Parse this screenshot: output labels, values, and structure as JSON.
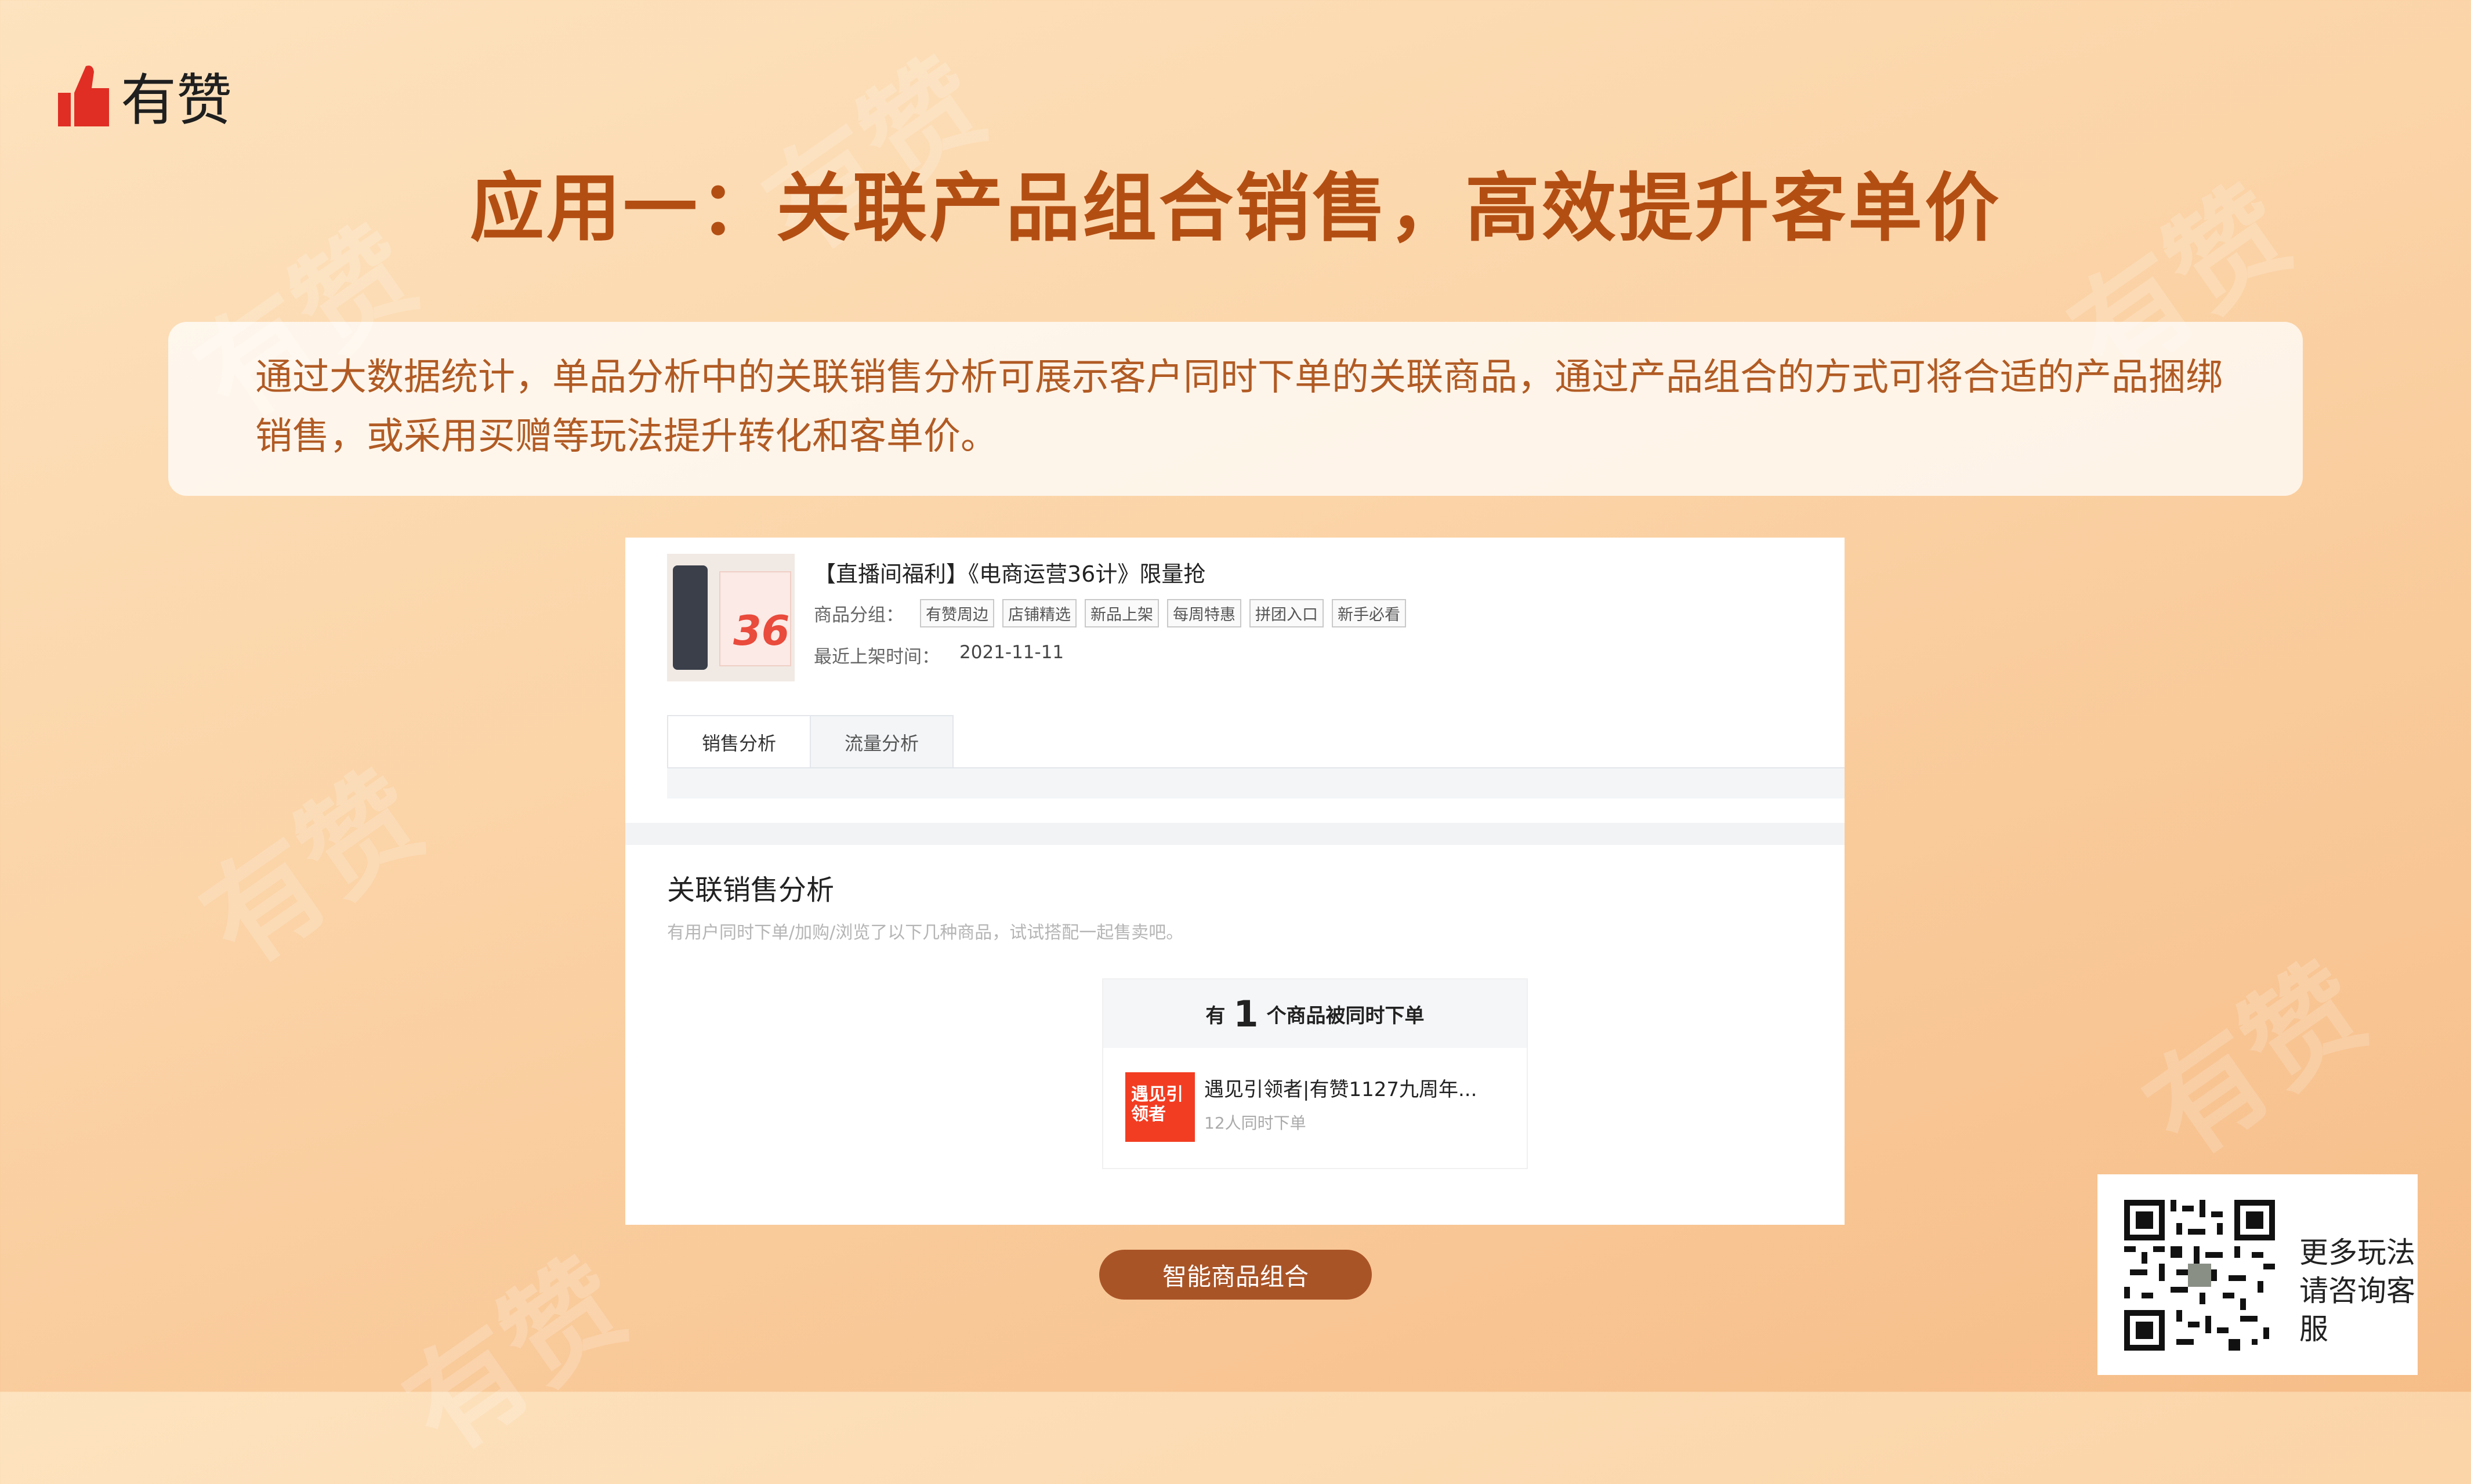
{
  "brand": {
    "name": "有赞",
    "color": "#e02e24"
  },
  "watermark": "有赞",
  "title": "应用一：关联产品组合销售，高效提升客单价",
  "description": "通过大数据统计，单品分析中的关联销售分析可展示客户同时下单的关联商品，通过产品组合的方式可将合适的产品捆绑销售，或采用买赠等玩法提升转化和客单价。",
  "product": {
    "title": "【直播间福利】《电商运营36计》限量抢",
    "group_label": "商品分组：",
    "groups": [
      "有赞周边",
      "店铺精选",
      "新品上架",
      "每周特惠",
      "拼团入口",
      "新手必看"
    ],
    "date_label": "最近上架时间：",
    "date": "2021-11-11"
  },
  "tabs": [
    {
      "label": "销售分析",
      "active": true
    },
    {
      "label": "流量分析",
      "active": false
    }
  ],
  "section": {
    "title": "关联销售分析",
    "subtitle": "有用户同时下单/加购/浏览了以下几种商品，试试搭配一起售卖吧。"
  },
  "related": {
    "prefix": "有",
    "count": "1",
    "suffix": "个商品被同时下单",
    "item_image_text": "遇见引领者",
    "item_name": "遇见引领者|有赞1127九周年...",
    "item_meta": "12人同时下单"
  },
  "caption": "智能商品组合",
  "qr_text": "更多玩法请咨询客服",
  "colors": {
    "title": "#b34e13",
    "desc": "#b15b24",
    "caption_bg": "#a95427"
  }
}
